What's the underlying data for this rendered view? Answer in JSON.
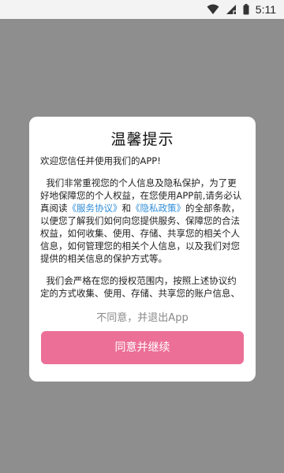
{
  "status_bar": {
    "time": "5:11",
    "icons": [
      "wifi-icon",
      "signal-icon",
      "battery-icon"
    ]
  },
  "dialog": {
    "title": "温馨提示",
    "greeting": "欢迎您信任并使用我们的APP!",
    "paragraph1_before": "我们非常重视您的个人信息及隐私保护，为了更好地保障您的个人权益，在您使用APP前,请务必认真阅读",
    "service_link": "《服务协议》",
    "and_text": "和",
    "privacy_link": "《隐私政策》",
    "paragraph1_after": "的全部条款，以便您了解我们如何向您提供服务、保障您的合法权益，如何收集、使用、存储、共享您的相关个人信息，如何管理您的相关个人信息，以及我们对您提供的相关信息的保护方式等。",
    "paragraph2": "我们会严格在您的授权范围内，按照上述协议约定的方式收集、使用、存储、共享您的账户信息、",
    "disagree_label": "不同意，并退出App",
    "agree_label": "同意并继续"
  },
  "colors": {
    "overlay": "#8e8e8e",
    "dialog_bg": "#ffffff",
    "link": "#2f8cd6",
    "accent": "#ec6f98",
    "muted_text": "#888888"
  }
}
